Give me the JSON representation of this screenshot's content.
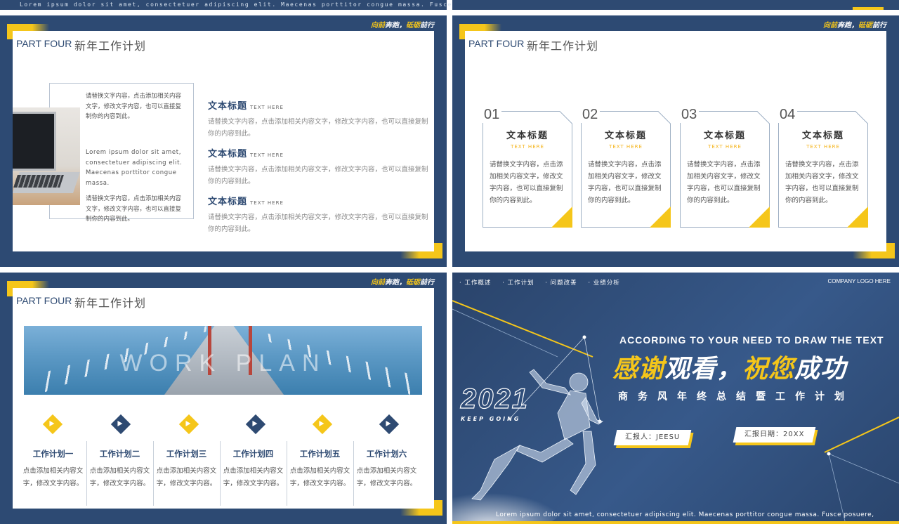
{
  "top_strip": {
    "left_text": "Lorem ipsum dolor sit amet, consectetuer adipiscing elit. Maecenas porttitor congue massa. Fusce posuere,"
  },
  "common": {
    "slogan_a": "向前",
    "slogan_b": "奔跑，",
    "slogan_c": "砥砺",
    "slogan_d": "前行",
    "part_label": "PART FOUR",
    "part_title": "新年工作计划"
  },
  "slide1": {
    "frame_text_1": "请替换文字内容，点击添加相关内容文字，修改文字内容，也可以直接复制你的内容到此。",
    "frame_text_2": "Lorem ipsum dolor sit amet, consectetuer adipiscing elit. Maecenas porttitor congue massa.",
    "frame_text_3": "请替换文字内容，点击添加相关内容文字，修改文字内容，也可以直接复制你的内容到此。",
    "items": [
      {
        "title": "文本标题",
        "sub": "TEXT HERE",
        "body": "请替换文字内容，点击添加相关内容文字，修改文字内容，也可以直接复制你的内容到此。"
      },
      {
        "title": "文本标题",
        "sub": "TEXT HERE",
        "body": "请替换文字内容，点击添加相关内容文字，修改文字内容，也可以直接复制你的内容到此。"
      },
      {
        "title": "文本标题",
        "sub": "TEXT HERE",
        "body": "请替换文字内容，点击添加相关内容文字，修改文字内容，也可以直接复制你的内容到此。"
      }
    ]
  },
  "slide2": {
    "cards": [
      {
        "num": "01",
        "title": "文本标题",
        "sub": "TEXT HERE",
        "body": "请替换文字内容，点击添加相关内容文字，修改文字内容，也可以直接复制你的内容到此。"
      },
      {
        "num": "02",
        "title": "文本标题",
        "sub": "TEXT HERE",
        "body": "请替换文字内容，点击添加相关内容文字，修改文字内容，也可以直接复制你的内容到此。"
      },
      {
        "num": "03",
        "title": "文本标题",
        "sub": "TEXT HERE",
        "body": "请替换文字内容，点击添加相关内容文字，修改文字内容，也可以直接复制你的内容到此。"
      },
      {
        "num": "04",
        "title": "文本标题",
        "sub": "TEXT HERE",
        "body": "请替换文字内容，点击添加相关内容文字，修改文字内容，也可以直接复制你的内容到此。"
      }
    ]
  },
  "slide3": {
    "banner_text": "WORK PLAN",
    "columns": [
      {
        "title": "工作计划一",
        "body": "点击添加相关内容文字，修改文字内容。"
      },
      {
        "title": "工作计划二",
        "body": "点击添加相关内容文字，修改文字内容。"
      },
      {
        "title": "工作计划三",
        "body": "点击添加相关内容文字，修改文字内容。"
      },
      {
        "title": "工作计划四",
        "body": "点击添加相关内容文字，修改文字内容。"
      },
      {
        "title": "工作计划五",
        "body": "点击添加相关内容文字，修改文字内容。"
      },
      {
        "title": "工作计划六",
        "body": "点击添加相关内容文字，修改文字内容。"
      }
    ]
  },
  "slide4": {
    "nav": [
      "· 工作概述",
      "· 工作计划",
      "· 问题改善",
      "· 业绩分析"
    ],
    "logo": "COMPANY LOGO HERE",
    "according": "ACCORDING TO  YOUR NEED TO DRAW THE TEXT",
    "thanks_a": "感谢",
    "thanks_b": "观看，",
    "thanks_c": "祝您",
    "thanks_d": "成功",
    "subtitle": "商务风年终总结暨工作计划",
    "year": "2021",
    "keep_going": "KEEP GOING",
    "reporter": "汇报人：JEESU",
    "date": "汇报日期：20XX",
    "bottom_text": "Lorem ipsum dolor sit amet, consectetuer adipiscing elit. Maecenas porttitor congue massa. Fusce posuere,"
  },
  "colors": {
    "navy": "#2d4a73",
    "accent_yellow": "#f5c61a",
    "title_blue": "#2e4a72"
  }
}
